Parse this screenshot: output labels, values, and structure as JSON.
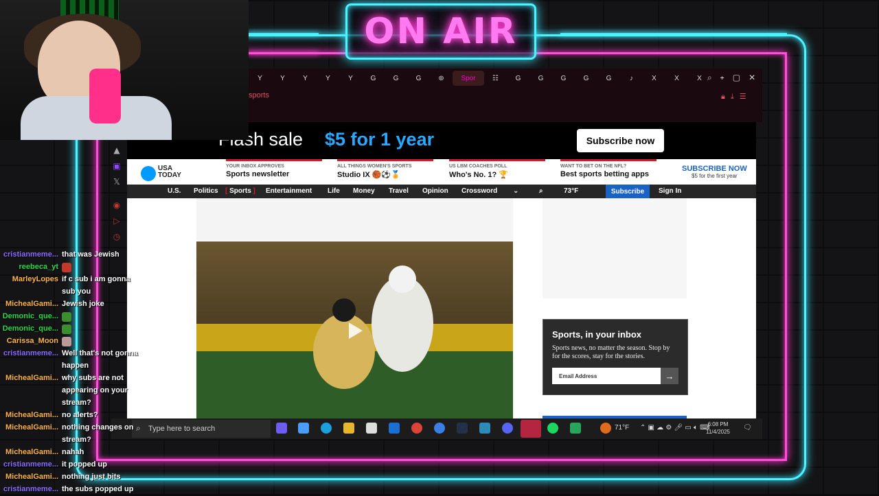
{
  "overlay": {
    "onair": "ON AIR"
  },
  "browser": {
    "active_tab": "Spor",
    "tab_glyphs": [
      "Y",
      "Y",
      "Y",
      "Y",
      "Y",
      "G",
      "G",
      "G",
      "⊚",
      "Spor",
      "☷",
      "G",
      "G",
      "G",
      "G",
      "G",
      "♪",
      "X",
      "X",
      "X",
      "+"
    ],
    "address": "sports",
    "colors": {
      "accent": "#e0506a"
    }
  },
  "page": {
    "promo": {
      "text1": "Flash sale",
      "text2": "$5 for 1 year",
      "button": "Subscribe now"
    },
    "header": {
      "logo": [
        "USA",
        "TODAY"
      ],
      "blocks": [
        {
          "kicker": "YOUR INBOX APPROVES",
          "title": "Sports newsletter"
        },
        {
          "kicker": "ALL THINGS WOMEN'S SPORTS",
          "title": "Studio IX 🏀⚽🏅"
        },
        {
          "kicker": "US LBM COACHES POLL",
          "title": "Who's No. 1? 🏆"
        },
        {
          "kicker": "WANT TO BET ON THE NFL?",
          "title": "Best sports betting apps"
        }
      ],
      "subscribe": {
        "label": "SUBSCRIBE NOW",
        "sub": "$5 for the first year"
      }
    },
    "nav": {
      "items": [
        "U.S.",
        "Politics",
        "Sports",
        "Entertainment",
        "Life",
        "Money",
        "Travel",
        "Opinion",
        "Crossword"
      ],
      "weather": "73°F",
      "subscribe": "Subscribe",
      "signin": "Sign In"
    },
    "inbox": {
      "title": "Sports, in your inbox",
      "desc": "Sports news, no matter the season. Stop by for the scores, stay for the stories.",
      "placeholder": "Email Address"
    }
  },
  "taskbar": {
    "search_placeholder": "Type here to search",
    "weather": "71°F",
    "time": "6:08 PM",
    "date": "11/4/2025"
  },
  "chat": [
    {
      "user": "cristianmeme...",
      "color": "#8a6bff",
      "msg": "that was Jewish"
    },
    {
      "user": "reebeca_yt",
      "color": "#2bd94a",
      "msg": ""
    },
    {
      "user": "MarleyLopes",
      "color": "#ffb64a",
      "msg": "if c sub i am gonna"
    },
    {
      "user": "",
      "color": "#fff",
      "msg": "sub you"
    },
    {
      "user": "MichealGami...",
      "color": "#ffb64a",
      "msg": "Jewish joke"
    },
    {
      "user": "Demonic_que...",
      "color": "#2bd94a",
      "msg": ""
    },
    {
      "user": "Demonic_que...",
      "color": "#2bd94a",
      "msg": ""
    },
    {
      "user": "Carissa_Moon",
      "color": "#ffb64a",
      "msg": ""
    },
    {
      "user": "cristianmeme...",
      "color": "#8a6bff",
      "msg": "Well that's not gonna"
    },
    {
      "user": "",
      "color": "#fff",
      "msg": "happen"
    },
    {
      "user": "MichealGami...",
      "color": "#ffb64a",
      "msg": "why subs are not"
    },
    {
      "user": "",
      "color": "#fff",
      "msg": "appearing on your"
    },
    {
      "user": "",
      "color": "#fff",
      "msg": "stream?"
    },
    {
      "user": "MichealGami...",
      "color": "#ffb64a",
      "msg": "no alerts?"
    },
    {
      "user": "MichealGami...",
      "color": "#ffb64a",
      "msg": "nothing changes on"
    },
    {
      "user": "",
      "color": "#fff",
      "msg": "stream?"
    },
    {
      "user": "MichealGami...",
      "color": "#ffb64a",
      "msg": "nahah"
    },
    {
      "user": "cristianmeme...",
      "color": "#8a6bff",
      "msg": "it popped up"
    },
    {
      "user": "MichealGami...",
      "color": "#ffb64a",
      "msg": "nothing just bits"
    },
    {
      "user": "cristianmeme...",
      "color": "#8a6bff",
      "msg": "the subs popped up"
    }
  ]
}
